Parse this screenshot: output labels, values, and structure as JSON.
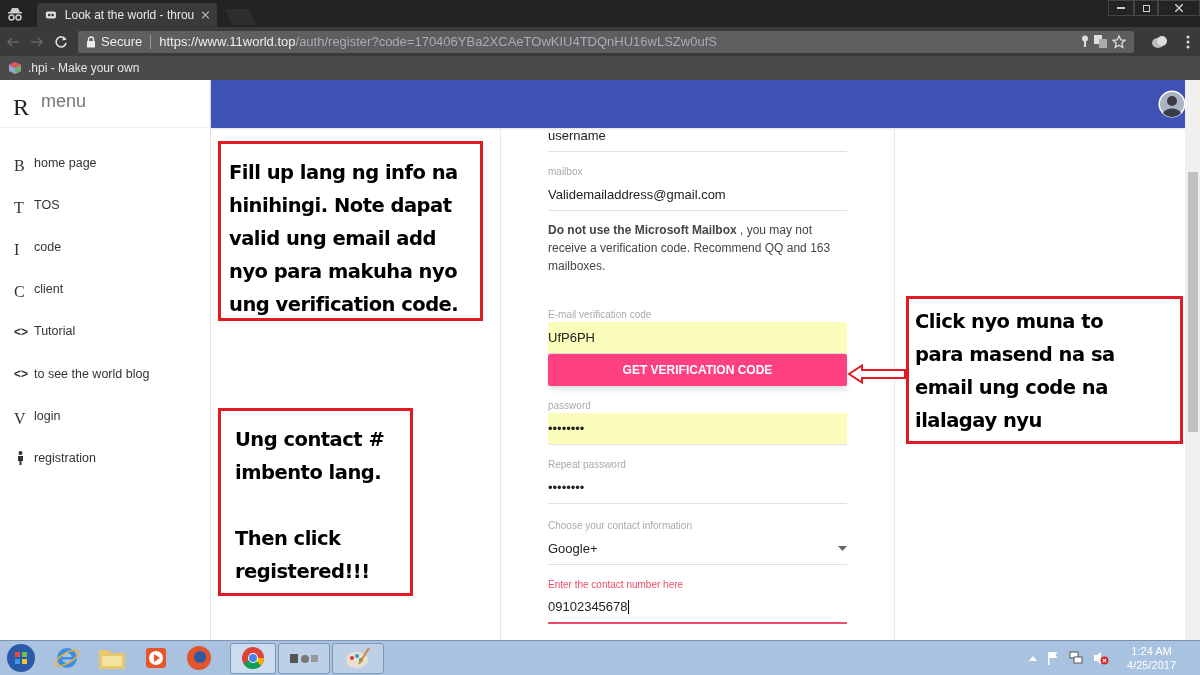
{
  "browser": {
    "tab_title": "Look at the world - throu",
    "url_secure": "Secure",
    "url_host": "https://www.11world.top",
    "url_path": "/auth/register?code=170406YBa2XCAeTOwKIU4TDQnHU16wLSZw0ufS",
    "bookmark": ".hpi - Make your own"
  },
  "sidebar": {
    "logo": "R",
    "title": "menu",
    "items": [
      {
        "glyph": "B",
        "label": "home page"
      },
      {
        "glyph": "T",
        "label": "TOS"
      },
      {
        "glyph": "I",
        "label": "code"
      },
      {
        "glyph": "C",
        "label": "client"
      },
      {
        "glyph": "<>",
        "label": "Tutorial"
      },
      {
        "glyph": "<>",
        "label": "to see the world blog"
      },
      {
        "glyph": "V",
        "label": "login"
      },
      {
        "kind": "person",
        "label": "registration"
      }
    ]
  },
  "form": [
    {
      "kind": "field",
      "value": "username",
      "autofill": false,
      "focused": false
    },
    {
      "kind": "field",
      "label": "mailbox",
      "value": "Validemailaddress@gmail.com",
      "autofill": false,
      "focused": false
    },
    {
      "kind": "note",
      "text": "**Do not use the Microsoft Mailbox** , you may not receive a verification code. Recommend QQ and 163 mailboxes."
    },
    {
      "kind": "field",
      "label": "E-mail verification code",
      "value": "UfP6PH",
      "autofill": true,
      "focused": false
    },
    {
      "kind": "button",
      "label": "GET VERIFICATION CODE"
    },
    {
      "kind": "field",
      "label": "password",
      "value": "••••••••",
      "autofill": true,
      "focused": false
    },
    {
      "kind": "field",
      "label": "Repeat password",
      "value": "••••••••",
      "autofill": false,
      "focused": false
    },
    {
      "kind": "select",
      "label": "Choose your contact information",
      "value": "Google+"
    },
    {
      "kind": "field",
      "label": "Enter the contact number here",
      "value": "09102345678",
      "autofill": false,
      "focused": true
    }
  ],
  "annotations": [
    {
      "text": "Fill up lang ng info na hinihingi. Note dapat valid ung email add nyo para makuha nyo ung verification code."
    },
    {
      "text": "Ung contact # imbento lang.\n\nThen click registered!!!"
    },
    {
      "text": "Click nyo muna to para masend na sa email ung code na ilalagay nyu"
    }
  ],
  "taskbar": {
    "time": "1:24 AM",
    "date": "4/25/2017"
  }
}
